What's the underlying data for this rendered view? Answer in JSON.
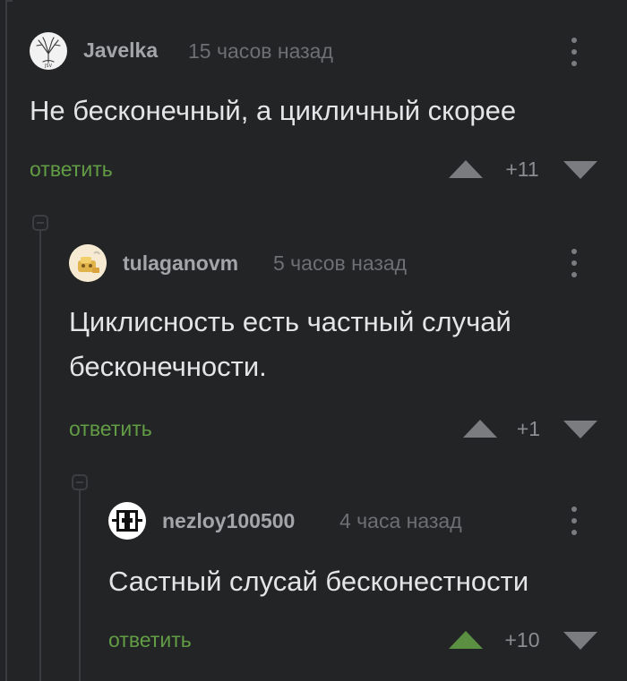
{
  "comments": [
    {
      "username": "Javelka",
      "time": "15 часов назад",
      "text_lines": [
        "Не бесконечный, а цикличный скорее"
      ],
      "reply_label": "ответить",
      "score": "+11",
      "voted_up": false,
      "avatar_icon": "tree-sketch-avatar"
    },
    {
      "username": "tulaganovm",
      "time": "5 часов назад",
      "text_lines": [
        "Циклисность есть частный случай",
        "бесконечности."
      ],
      "reply_label": "ответить",
      "score": "+1",
      "voted_up": false,
      "avatar_icon": "cartoon-avatar"
    },
    {
      "username": "nezloy100500",
      "time": "4 часа назад",
      "text_lines": [
        "Састный слусай бесконестности"
      ],
      "reply_label": "ответить",
      "score": "+10",
      "voted_up": true,
      "avatar_icon": "logo-avatar"
    }
  ],
  "colors": {
    "background": "#232426",
    "thread_line": "#3b3c3f",
    "reply_link": "#629c44",
    "upvote_active": "#5b8f41",
    "vote_inactive": "#7a7c80"
  }
}
